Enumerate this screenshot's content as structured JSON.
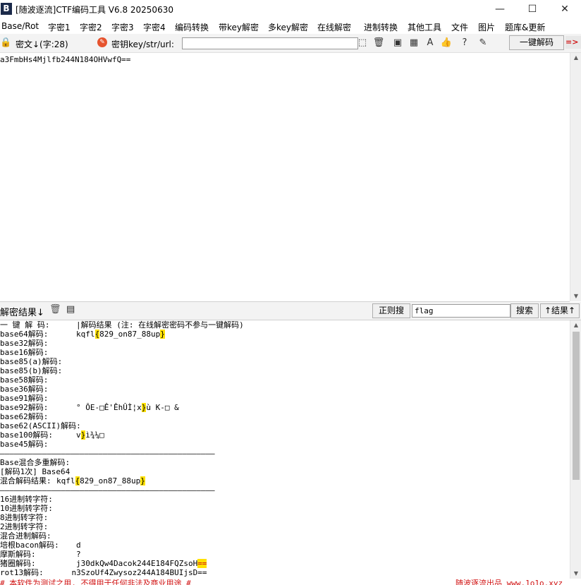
{
  "window": {
    "icon_letter": "B",
    "title": "[随波逐流]CTF编码工具 V6.8  20250630",
    "minimize": "—",
    "maximize": "☐",
    "close": "✕"
  },
  "menu": [
    "Base/Rot",
    "字密1",
    "字密2",
    "字密3",
    "字密4",
    "编码转换",
    "带key解密",
    "多key解密",
    "在线解密",
    "进制转换",
    "其他工具",
    "文件",
    "图片",
    "题库&更新"
  ],
  "toolbar": {
    "cipher_label": "密文↓(字:28)",
    "key_label": "密钥key/str/url:",
    "key_value": "",
    "one_click_decode": "一键解码",
    "arrow_glyph": "=>"
  },
  "cipher_text": "a3FmbHs4Mjlfb244N184OHVwfQ==",
  "results_bar": {
    "label": "解密结果↓",
    "regex_search": "正则搜",
    "search_value": "flag",
    "search_button": "搜索",
    "up_result": "↑结果↑"
  },
  "results": {
    "header_left": "一 键 解 码:",
    "header_right": "|解码结果 (注: 在线解密密码不参与一键解码)",
    "rows": [
      {
        "label": "base64解码:",
        "value": "kqfl{829_on87_88up}"
      },
      {
        "label": "base32解码:",
        "value": ""
      },
      {
        "label": "base16解码:",
        "value": ""
      },
      {
        "label": "base85(a)解码:",
        "value": ""
      },
      {
        "label": "base85(b)解码:",
        "value": ""
      },
      {
        "label": "base58解码:",
        "value": ""
      },
      {
        "label": "base36解码:",
        "value": ""
      },
      {
        "label": "base91解码:",
        "value": ""
      },
      {
        "label": "base92解码:",
        "value": "° ÔE-□Ê'ÊhÛÌ¦x}ù K-□ &"
      },
      {
        "label": "base62解码:",
        "value": ""
      },
      {
        "label": "base62(ASCII)解码:",
        "value": ""
      },
      {
        "label": "base100解码:",
        "value": "v}ì¾¼□"
      },
      {
        "label": "base45解码:",
        "value": ""
      }
    ],
    "divider": "——————————————————————————————————————————————",
    "mixed_title": "Base混合多重解码:",
    "mixed_step": "[解码1次] Base64",
    "mixed_result_label": "混合解码结果:",
    "mixed_result_value": "kqfl{829_on87_88up}",
    "rows2": [
      {
        "label": "16进制转字符:",
        "value": ""
      },
      {
        "label": "10进制转字符:",
        "value": ""
      },
      {
        "label": "8进制转字符:",
        "value": ""
      },
      {
        "label": "2进制转字符:",
        "value": ""
      },
      {
        "label": "混合进制解码:",
        "value": ""
      },
      {
        "label": "培根bacon解码:",
        "value": "d"
      },
      {
        "label": "摩斯解码:",
        "value": "?"
      },
      {
        "label": "猪圈解码:",
        "value": "j30dkQw4Dacok244E184FQZsoH=="
      }
    ],
    "partial_line": "rot13解码:      n3SzoUf4Zwysoz244A184BUIjsD=="
  },
  "footer": {
    "left": "# 本软件为测试之用, 不得用于任何非法及商业用途 #",
    "right": "随波逐流出品 www.1o1o.xyz"
  },
  "colors": {
    "highlight": "#ffe100",
    "bracket_highlight": "#9ad0ff",
    "footer_text": "#d01010"
  }
}
